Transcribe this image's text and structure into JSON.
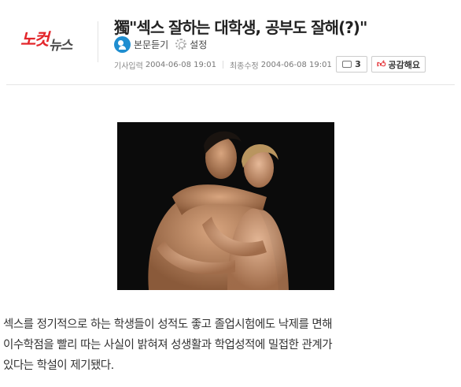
{
  "header": {
    "logo": {
      "part1": "노컷",
      "part2": "뉴스"
    },
    "title": "獨\"섹스 잘하는 대학생, 공부도 잘해(?)\"",
    "tools": {
      "listen_label": "본문듣기",
      "settings_label": "설정"
    },
    "meta": {
      "published_label": "기사입력",
      "published_value": "2004-06-08 19:01",
      "updated_label": "최종수정",
      "updated_value": "2004-06-08 19:01"
    },
    "comment_count": "3",
    "like_label": "공감해요"
  },
  "article": {
    "lines": [
      "섹스를 정기적으로 하는 학생들이 성적도 좋고 졸업시험에도 낙제를 면해",
      "이수학점을 빨리 따는 사실이 밝혀져 성생활과 학업성적에 밀접한 관계가",
      "있다는 학설이 제기됐다."
    ]
  },
  "colors": {
    "brand_red": "#e3262b",
    "listen_blue": "#1f8ed0"
  },
  "icons": [
    "listen-icon",
    "gear-icon",
    "comment-icon",
    "thumbs-up-icon"
  ]
}
